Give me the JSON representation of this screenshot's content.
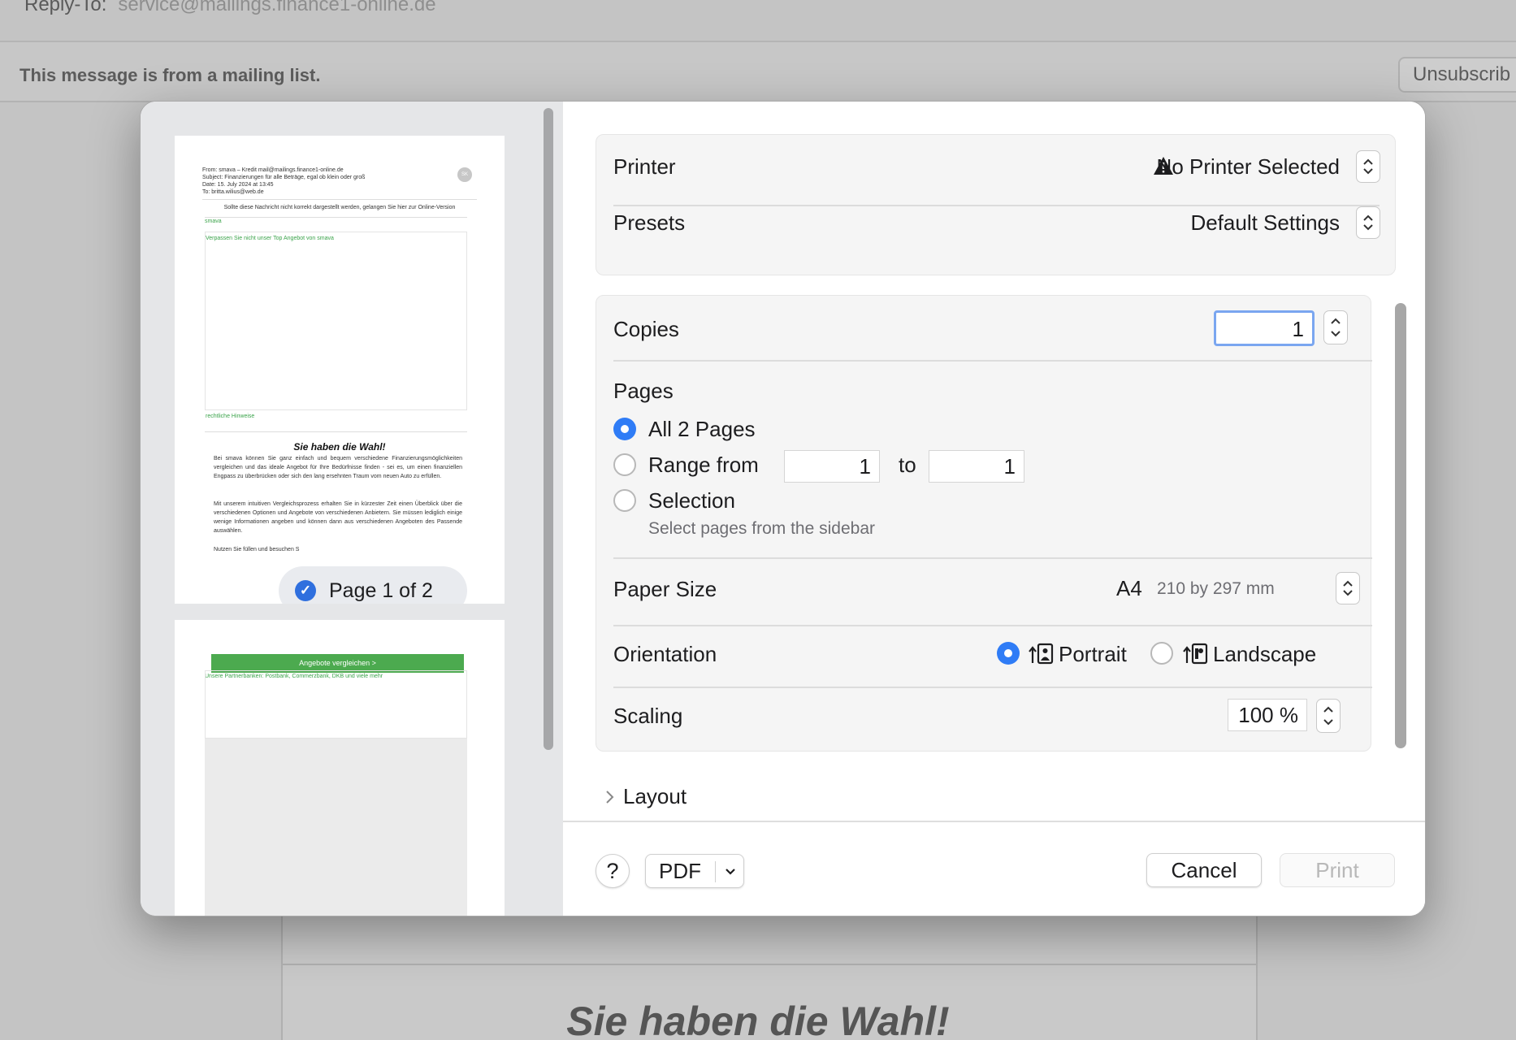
{
  "background": {
    "reply_to_label": "Reply-To:",
    "reply_to_value": "service@mailings.finance1-online.de",
    "mailing_list_notice": "This message is from a mailing list.",
    "unsubscribe_label": "Unsubscrib",
    "content_title": "Sie haben die Wahl!"
  },
  "sidebar": {
    "page_badge": "Page 1 of 2",
    "thumb1": {
      "header_lines": [
        "From:  smava – Kredit mail@mailings.finance1-online.de",
        "Subject:  Finanzierungen für alle Beträge, egal ob klein oder groß",
        "Date:  15. July 2024 at 13:45",
        "To:  britta.wilius@web.de"
      ],
      "avatar_initials": "SK",
      "online_notice": "Sollte diese Nachricht nicht korrekt dargestellt werden, gelangen Sie hier zur Online-Version",
      "brand": "smava",
      "teaser": "Verpassen Sie nicht unser Top Angebot von smava",
      "legal": "rechtliche Hinweise",
      "title": "Sie haben die Wahl!",
      "para1": "Bei smava können Sie ganz einfach und bequem verschiedene Finanzierungsmöglichkeiten vergleichen und das ideale Angebot für Ihre Bedürfnisse finden - sei es, um einen finanziellen Engpass zu überbrücken oder sich den lang ersehnten Traum vom neuen Auto zu erfüllen.",
      "para2": "Mit unserem intuitiven Vergleichsprozess erhalten Sie in kürzester Zeit einen Überblick über die verschiedenen Optionen und Angebote von verschiedenen Anbietern. Sie müssen lediglich einige wenige Informationen angeben und können dann aus verschiedenen Angeboten des Passende auswählen.",
      "para3": "Nutzen Sie                                                                    füllen und besuchen S"
    },
    "thumb2": {
      "button": "Angebote vergleichen >",
      "partners": "Unsere Partnerbanken: Postbank, Commerzbank, DKB und viele mehr"
    }
  },
  "printer": {
    "label": "Printer",
    "value": "No Printer Selected"
  },
  "presets": {
    "label": "Presets",
    "value": "Default Settings"
  },
  "copies": {
    "label": "Copies",
    "value": "1"
  },
  "pages": {
    "label": "Pages",
    "all_label": "All 2 Pages",
    "range_label": "Range from",
    "range_from": "1",
    "range_to_label": "to",
    "range_to": "1",
    "selection_label": "Selection",
    "selection_hint": "Select pages from the sidebar",
    "selected": "all"
  },
  "paper_size": {
    "label": "Paper Size",
    "value": "A4",
    "detail": "210 by 297 mm"
  },
  "orientation": {
    "label": "Orientation",
    "portrait_label": "Portrait",
    "landscape_label": "Landscape",
    "selected": "portrait"
  },
  "scaling": {
    "label": "Scaling",
    "value": "100 %"
  },
  "layout": {
    "label": "Layout"
  },
  "footer": {
    "help_label": "?",
    "pdf_label": "PDF",
    "cancel_label": "Cancel",
    "print_label": "Print"
  },
  "colors": {
    "accent": "#2f7cf6",
    "checkmark": "#2f6fde",
    "green_link": "#3aa34a",
    "green_button": "#4caa4f"
  },
  "icons": [
    "warning-icon",
    "updown-chevron-icon",
    "checkmark-icon",
    "chevron-right-icon",
    "chevron-down-icon",
    "portrait-orientation-icon",
    "landscape-orientation-icon"
  ]
}
